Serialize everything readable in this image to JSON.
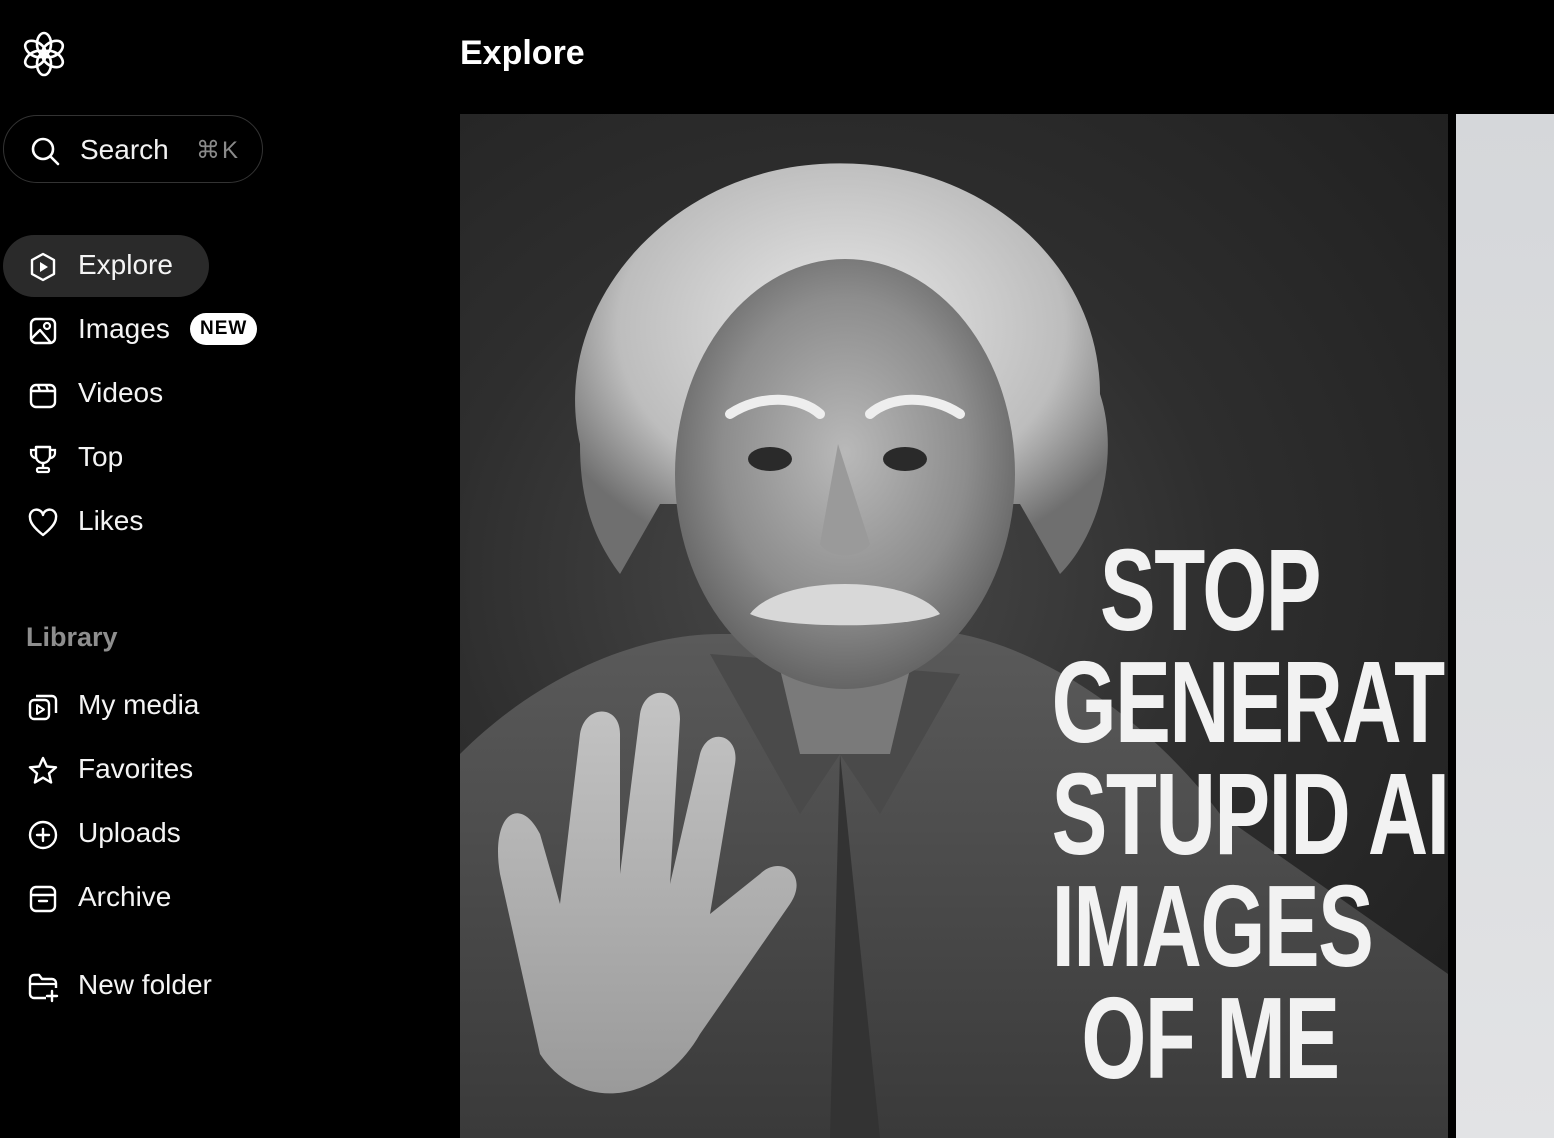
{
  "sidebar": {
    "search": {
      "label": "Search",
      "shortcut": "⌘K"
    },
    "nav": [
      {
        "label": "Explore",
        "icon": "explore-icon",
        "active": true
      },
      {
        "label": "Images",
        "icon": "image-icon",
        "badge": "NEW"
      },
      {
        "label": "Videos",
        "icon": "video-icon"
      },
      {
        "label": "Top",
        "icon": "trophy-icon"
      },
      {
        "label": "Likes",
        "icon": "heart-icon"
      }
    ],
    "library_label": "Library",
    "library": [
      {
        "label": "My media",
        "icon": "media-icon"
      },
      {
        "label": "Favorites",
        "icon": "star-icon"
      },
      {
        "label": "Uploads",
        "icon": "upload-plus-icon"
      },
      {
        "label": "Archive",
        "icon": "archive-icon"
      }
    ],
    "new_folder": {
      "label": "New folder",
      "icon": "new-folder-icon"
    }
  },
  "header": {
    "title": "Explore"
  },
  "feed": {
    "items": [
      {
        "caption_lines": [
          "STOP",
          "GENERATING",
          "STUPID AI",
          "IMAGES",
          "OF ME"
        ]
      }
    ]
  }
}
